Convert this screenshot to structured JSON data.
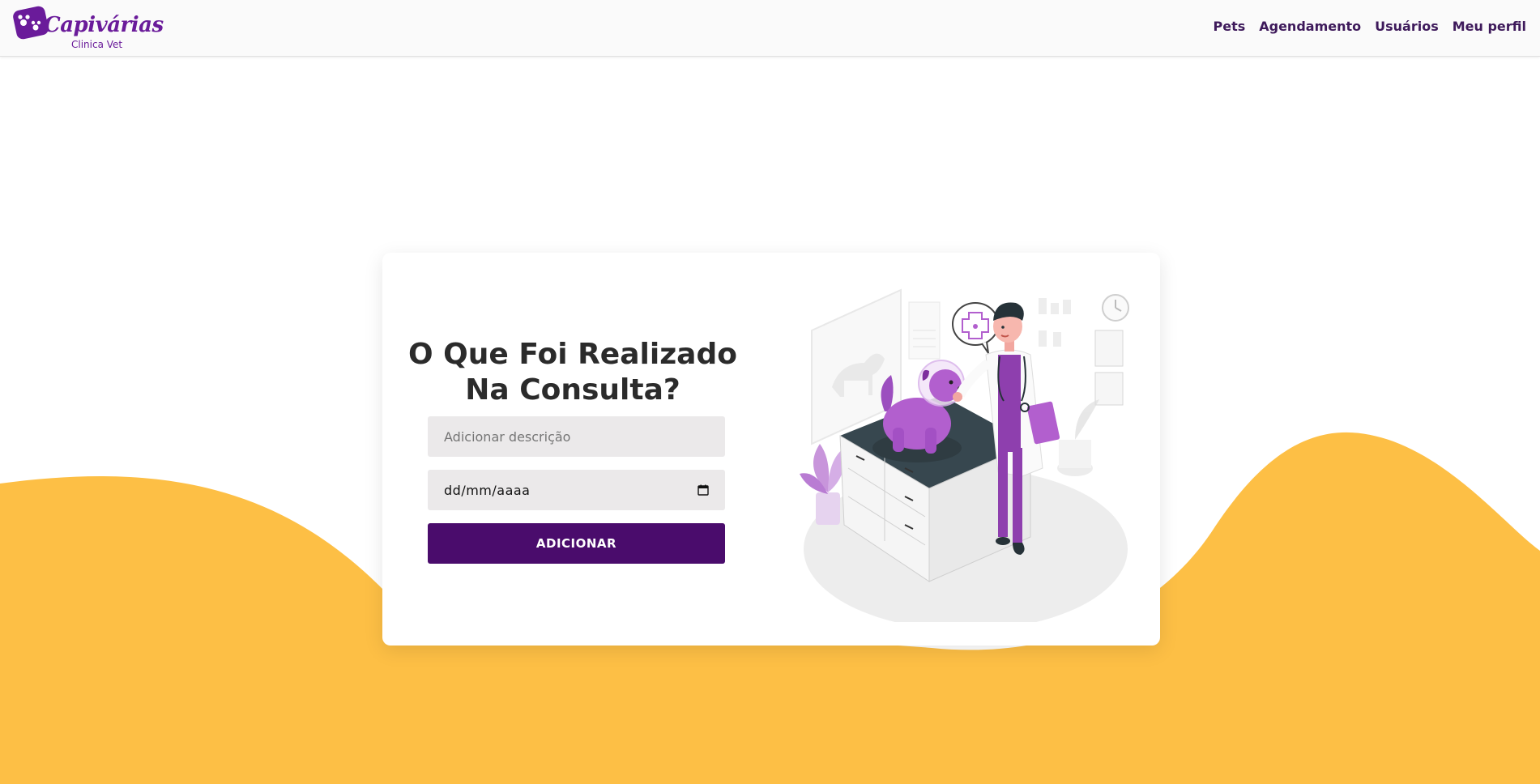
{
  "brand": {
    "title": "Capivárias",
    "subtitle": "Clinica Vet",
    "logo_icon": "paw-badge-icon"
  },
  "nav": {
    "links": [
      {
        "label": "Pets"
      },
      {
        "label": "Agendamento"
      },
      {
        "label": "Usuários"
      },
      {
        "label": "Meu perfil"
      }
    ]
  },
  "form": {
    "heading": "O Que Foi Realizado Na Consulta?",
    "description_placeholder": "Adicionar descrição",
    "date_placeholder": "dd/mm/aaaa",
    "submit_label": "ADICIONAR"
  },
  "colors": {
    "brand_purple": "#4a0c6c",
    "nav_link": "#3e1a5b",
    "wave_yellow": "#fdbf45",
    "input_bg": "#ebe9ea",
    "illustration_accent": "#b25fce"
  },
  "illustration": {
    "subject": "veterinarian-with-dog-illustration"
  }
}
